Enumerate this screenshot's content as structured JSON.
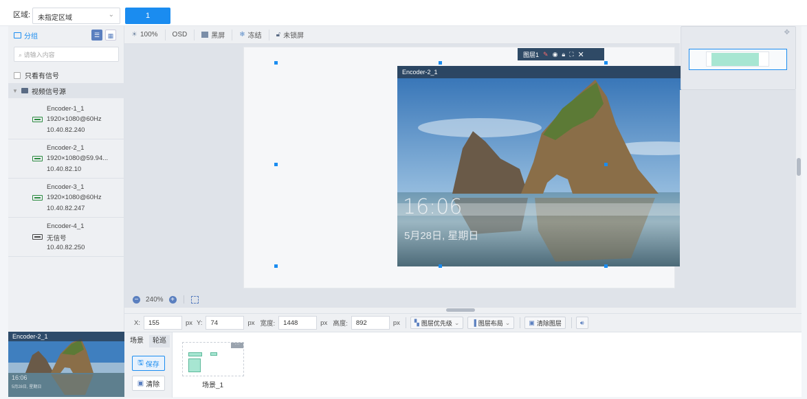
{
  "header": {
    "region_label": "区域:",
    "region_value": "未指定区域",
    "screen_tab": "1"
  },
  "sidebar": {
    "group_label": "分组",
    "search_placeholder": "请输入内容",
    "only_signal_label": "只看有信号",
    "tree_root": "视频信号源",
    "sources": [
      {
        "name": "Encoder-1_1",
        "res": "1920×1080@60Hz",
        "ip": "10.40.82.240",
        "signal": true
      },
      {
        "name": "Encoder-2_1",
        "res": "1920×1080@59.94...",
        "ip": "10.40.82.10",
        "signal": true
      },
      {
        "name": "Encoder-3_1",
        "res": "1920×1080@60Hz",
        "ip": "10.40.82.247",
        "signal": true
      },
      {
        "name": "Encoder-4_1",
        "res": "无信号",
        "ip": "10.40.82.250",
        "signal": false
      }
    ]
  },
  "toolbar": {
    "zoom": "100%",
    "osd": "OSD",
    "black": "黑屏",
    "freeze": "冻结",
    "lock": "未锁屏"
  },
  "canvas": {
    "layer_label": "图层1",
    "video_title": "Encoder-2_1",
    "time": "16:06",
    "date": "5月28日, 星期日",
    "zoom_value": "240%"
  },
  "position": {
    "x_label": "X:",
    "x": "155",
    "px": "px",
    "y_label": "Y:",
    "y": "74",
    "w_label": "宽度:",
    "w": "1448",
    "h_label": "高度:",
    "h": "892",
    "priority": "图层优先级",
    "layout": "图层布局",
    "clear_layers": "清除图层"
  },
  "preview": {
    "title": "Encoder-2_1",
    "time": "16:06",
    "date": "5月28日, 星期日"
  },
  "bottom": {
    "tab_scene": "场景",
    "tab_tour": "轮巡",
    "save": "保存",
    "clear": "清除",
    "scene_name": "场景_1"
  },
  "colors": {
    "accent": "#1a8cf0",
    "layer_bar": "#2f4a66"
  }
}
